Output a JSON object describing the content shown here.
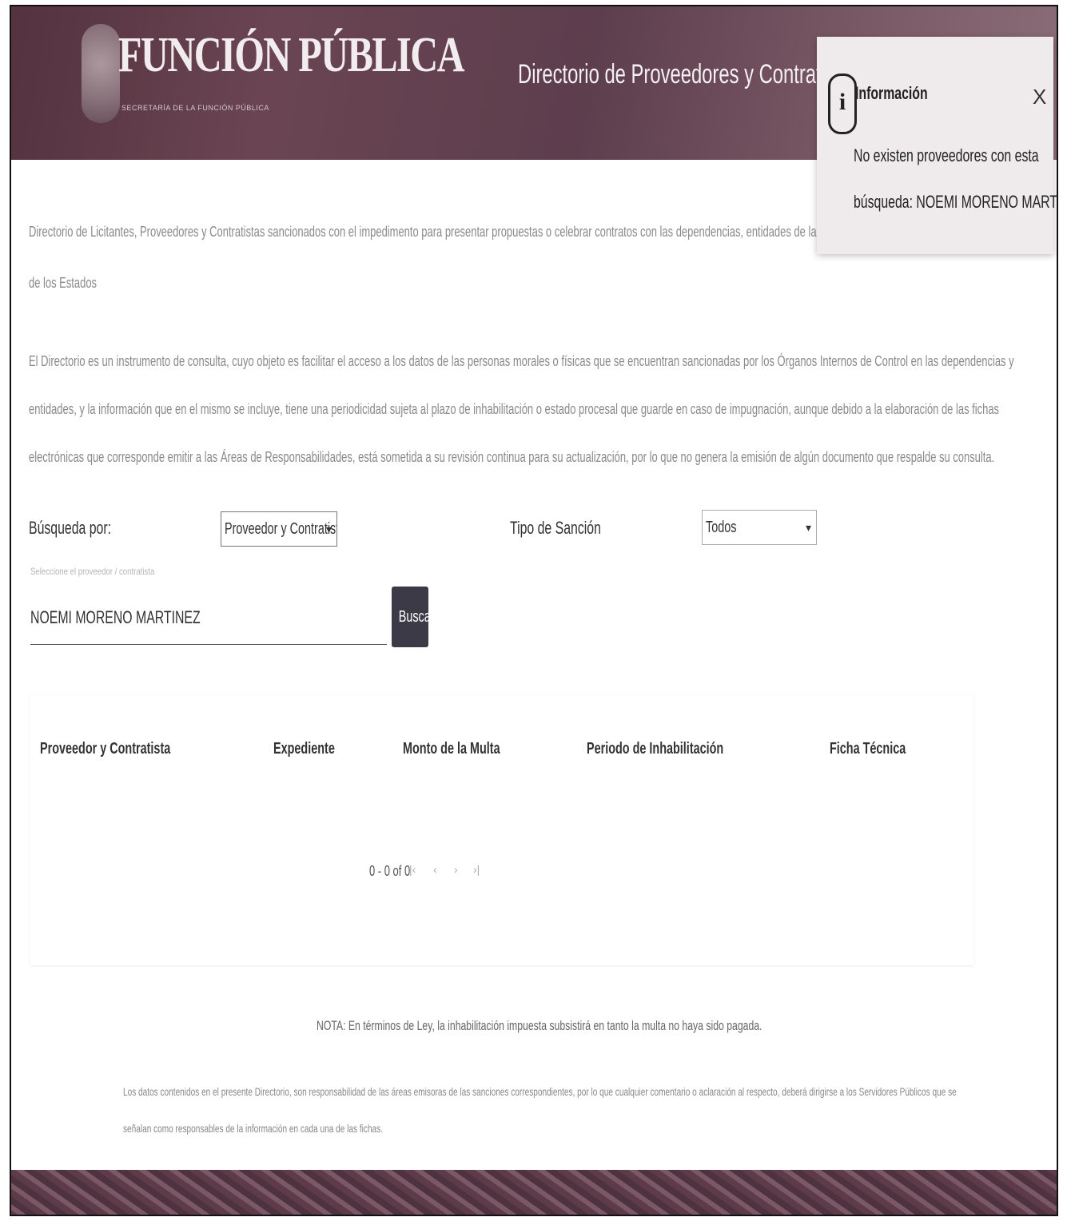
{
  "header": {
    "brand_title": "FUNCIÓN PÚBLICA",
    "brand_subtitle": "SECRETARÍA DE LA FUNCIÓN PÚBLICA",
    "page_title": "Directorio de Proveedores y Contratistas Sanci"
  },
  "toast": {
    "icon": "info-icon",
    "icon_glyph": "i",
    "title": "Información",
    "close_label": "X",
    "message_line1": "No existen proveedores con esta",
    "message_line2": "búsqueda: NOEMI MORENO MARTINEZ"
  },
  "intro": {
    "line1": "Directorio de Licitantes, Proveedores y Contratistas sancionados con el impedimento para presentar propuestas o celebrar contratos con las dependencias, entidades de la Administración",
    "line2": "de los Estados"
  },
  "description": {
    "line1": "El Directorio es un instrumento de consulta, cuyo objeto es facilitar el acceso a los datos de las personas morales o físicas que se encuentran sancionadas por los Órganos Internos de Control en las dependencias y",
    "line2": "entidades, y la información que en el mismo se incluye, tiene una periodicidad sujeta al plazo de inhabilitación o estado procesal que guarde en caso de impugnación, aunque debido a la elaboración de las fichas",
    "line3": "electrónicas que corresponde emitir a las Áreas de Responsabilidades, está sometida a su revisión continua para su actualización, por lo que no genera la emisión de algún documento que respalde su consulta."
  },
  "search": {
    "search_by_label": "Búsqueda por:",
    "search_by_value": "Proveedor y Contratista",
    "sanction_type_label": "Tipo de Sanción",
    "sanction_type_value": "Todos",
    "hint": "Seleccione el proveedor / contratista",
    "query_value": "NOEMI MORENO MARTINEZ",
    "button_label": "Buscar"
  },
  "table": {
    "columns": [
      "Proveedor y Contratista",
      "Expediente",
      "Monto de la Multa",
      "Periodo de Inhabilitación",
      "Ficha Técnica"
    ],
    "pagination": "0 - 0 of 0",
    "pager_first": "|‹",
    "pager_prev": "‹",
    "pager_next": "›",
    "pager_last": "›|"
  },
  "notes": {
    "nota": "NOTA: En términos de Ley, la inhabilitación impuesta subsistirá en tanto la multa no haya sido pagada.",
    "disclaimer_line1": "Los datos contenidos en el presente Directorio, son responsabilidad de las áreas emisoras de las sanciones correspondientes, por lo que cualquier comentario o aclaración al respecto, deberá dirigirse a los Servidores Públicos que se",
    "disclaimer_line2": "señalan como responsables de la información en cada una de las fichas."
  }
}
